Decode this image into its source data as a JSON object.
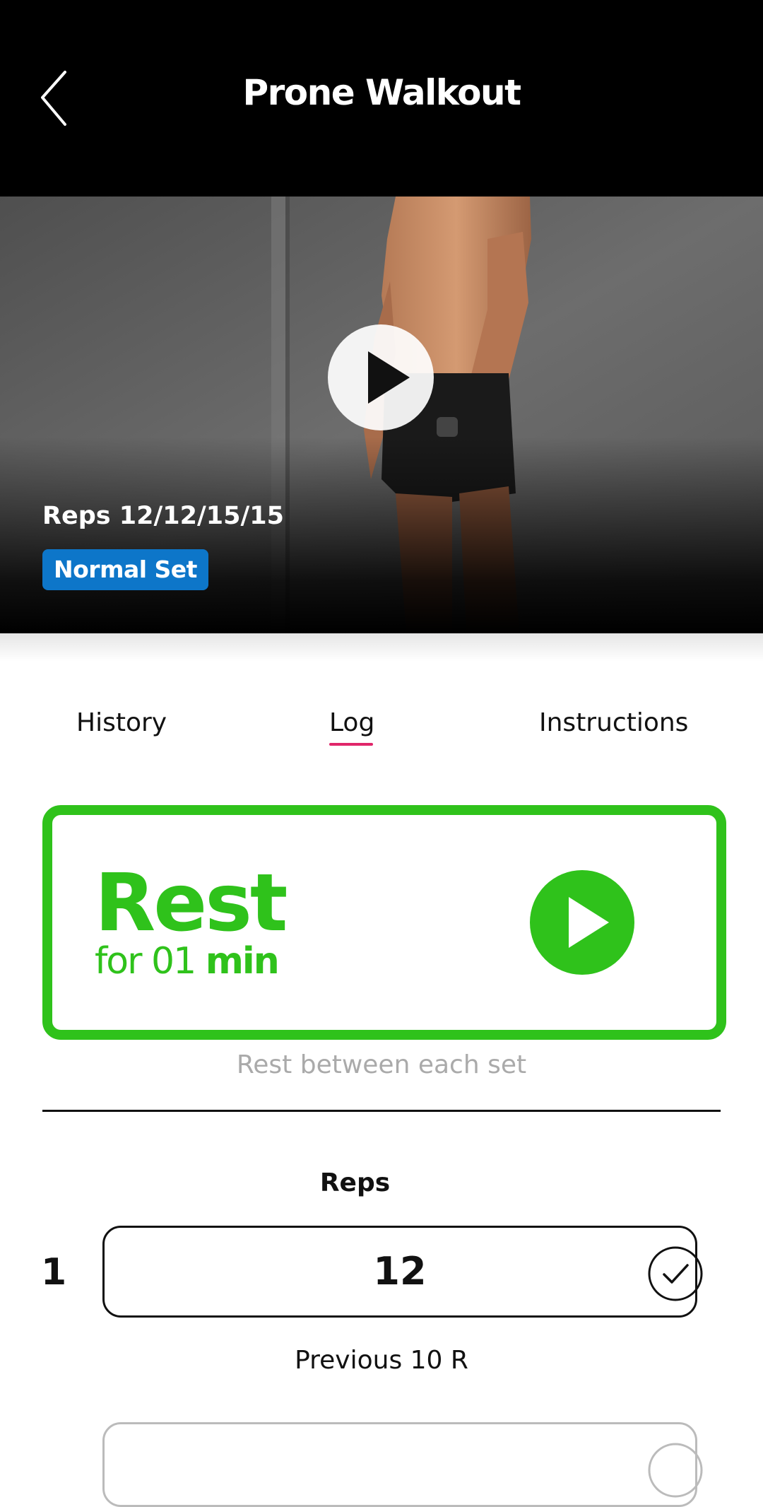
{
  "header": {
    "title": "Prone Walkout"
  },
  "hero": {
    "reps_text": "Reps 12/12/15/15",
    "set_type": "Normal Set",
    "set_type_color": "#0d76c9"
  },
  "tabs": [
    {
      "label": "History"
    },
    {
      "label": "Log",
      "active": true
    },
    {
      "label": "Instructions"
    }
  ],
  "rest": {
    "title": "Rest",
    "prefix": "for 01",
    "unit": "min",
    "note": "Rest between each set",
    "accent_color": "#2fc21b"
  },
  "log": {
    "column_header": "Reps",
    "sets": [
      {
        "number": "1",
        "value": "12",
        "previous": "Previous 10 R"
      }
    ]
  },
  "colors": {
    "tab_underline": "#e0266a"
  }
}
